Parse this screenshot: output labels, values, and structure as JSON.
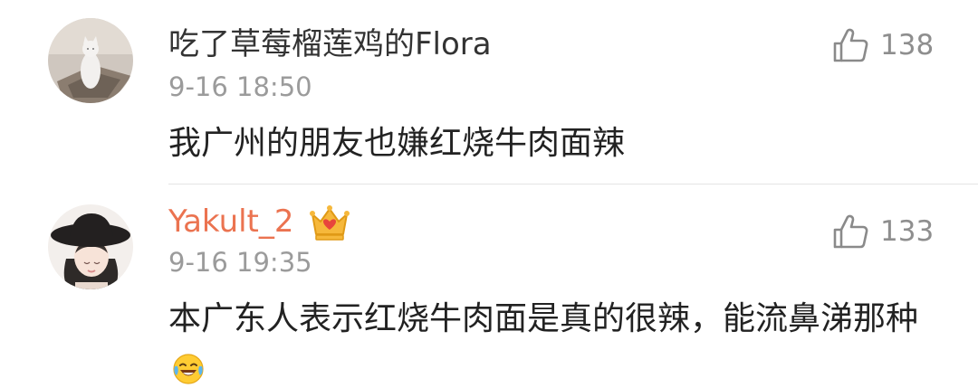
{
  "comments": [
    {
      "username": "吃了草莓榴莲鸡的Flora",
      "timestamp": "9-16 18:50",
      "likes": "138",
      "text": "我广州的朋友也嫌红烧牛肉面辣",
      "avatar_icon": "cat-avatar"
    },
    {
      "username": "Yakult_2",
      "username_color": "#eb7350",
      "badge_icon": "crown-icon",
      "timestamp": "9-16 19:35",
      "likes": "133",
      "text": "本广东人表示红烧牛肉面是真的很辣，能流鼻涕那种",
      "emoji_icon": "laughing-crying-emoji",
      "avatar_icon": "girl-hat-avatar"
    }
  ]
}
